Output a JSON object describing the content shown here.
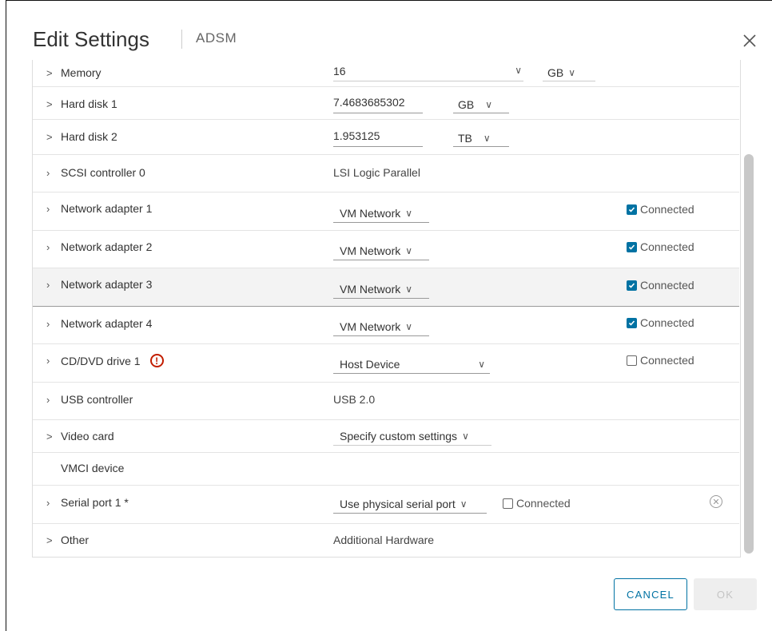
{
  "dialog": {
    "title": "Edit Settings",
    "subtitle": "ADSM",
    "close_icon": "close-icon"
  },
  "colors": {
    "accent": "#0072a3",
    "warning": "#c21d00",
    "row_highlight": "#f3f3f3"
  },
  "rows": [
    {
      "label": "Memory",
      "value": "16",
      "unit": "GB"
    },
    {
      "label": "Hard disk 1",
      "value": "7.4683685302",
      "unit": "GB"
    },
    {
      "label": "Hard disk 2",
      "value": "1.953125",
      "unit": "TB"
    },
    {
      "label": "SCSI controller 0",
      "value": "LSI Logic Parallel"
    },
    {
      "label": "Network adapter 1",
      "value": "VM Network",
      "connected_label": "Connected",
      "connected": true
    },
    {
      "label": "Network adapter 2",
      "value": "VM Network",
      "connected_label": "Connected",
      "connected": true
    },
    {
      "label": "Network adapter 3",
      "value": "VM Network",
      "connected_label": "Connected",
      "connected": true
    },
    {
      "label": "Network adapter 4",
      "value": "VM Network",
      "connected_label": "Connected",
      "connected": true
    },
    {
      "label": "CD/DVD drive 1",
      "warning_icon": "!",
      "value": "Host Device",
      "connected_label": "Connected",
      "connected": false
    },
    {
      "label": "USB controller",
      "value": "USB 2.0"
    },
    {
      "label": "Video card",
      "value": "Specify custom settings"
    },
    {
      "label": "VMCI device"
    },
    {
      "label": "Serial port 1 *",
      "value": "Use physical serial port",
      "connected_label": "Connected",
      "connected": false
    },
    {
      "label": "Other",
      "value": "Additional Hardware"
    }
  ],
  "footer": {
    "cancel_label": "CANCEL",
    "ok_label": "OK"
  }
}
